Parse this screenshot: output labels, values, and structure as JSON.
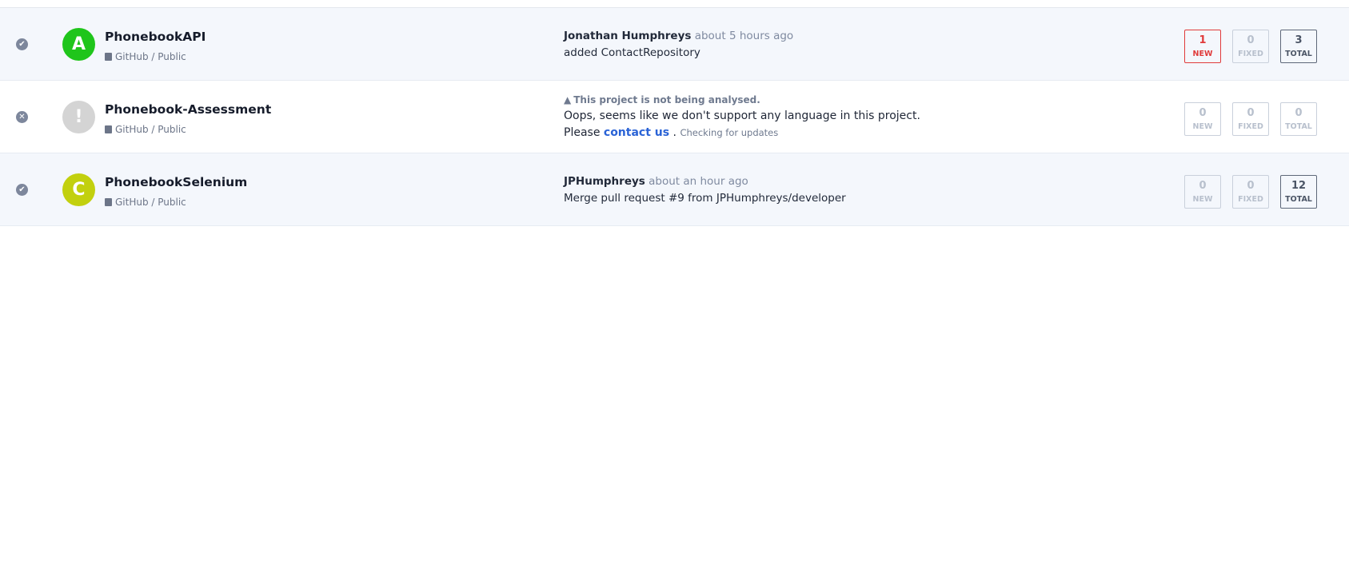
{
  "projects": [
    {
      "status_icon": "check-circle-icon",
      "avatar_letter": "A",
      "avatar_color": "#1fc51b",
      "name": "PhonebookAPI",
      "source": "GitHub / Public",
      "commit": {
        "author": "Jonathan Humphreys",
        "time": "about 5 hours ago",
        "message": "added ContactRepository"
      },
      "counters": {
        "new": {
          "value": "1",
          "label": "NEW"
        },
        "fixed": {
          "value": "0",
          "label": "FIXED"
        },
        "total": {
          "value": "3",
          "label": "TOTAL"
        }
      }
    },
    {
      "status_icon": "x-circle-icon",
      "avatar_letter": "!",
      "avatar_color": "#d4d4d4",
      "name": "Phonebook-Assessment",
      "source": "GitHub / Public",
      "warning": {
        "title": "This project is not being analysed.",
        "line1": "Oops, seems like we don't support any language in this project.",
        "line2_prefix": "Please",
        "link": "contact us",
        "line2_suffix": ".",
        "small": "Checking for updates"
      },
      "counters": {
        "new": {
          "value": "0",
          "label": "NEW"
        },
        "fixed": {
          "value": "0",
          "label": "FIXED"
        },
        "total": {
          "value": "0",
          "label": "TOTAL"
        }
      }
    },
    {
      "status_icon": "check-circle-icon",
      "avatar_letter": "C",
      "avatar_color": "#c2d00e",
      "name": "PhonebookSelenium",
      "source": "GitHub / Public",
      "commit": {
        "author": "JPHumphreys",
        "time": "about an hour ago",
        "message": "Merge pull request #9 from JPHumphreys/developer"
      },
      "counters": {
        "new": {
          "value": "0",
          "label": "NEW"
        },
        "fixed": {
          "value": "0",
          "label": "FIXED"
        },
        "total": {
          "value": "12",
          "label": "TOTAL"
        }
      }
    }
  ]
}
